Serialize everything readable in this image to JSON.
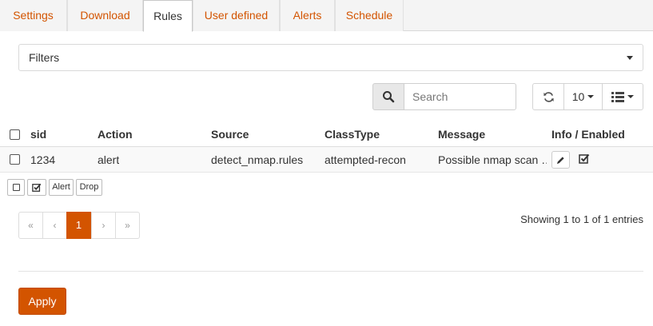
{
  "tabs": [
    {
      "label": "Settings"
    },
    {
      "label": "Download"
    },
    {
      "label": "Rules"
    },
    {
      "label": "User defined"
    },
    {
      "label": "Alerts"
    },
    {
      "label": "Schedule"
    }
  ],
  "active_tab": "Rules",
  "filters": {
    "value": "Filters"
  },
  "toolbar": {
    "search_placeholder": "Search",
    "rows_per_page": "10",
    "icons": [
      "search-icon",
      "refresh-icon",
      "list-icon"
    ]
  },
  "table": {
    "columns": [
      "sid",
      "Action",
      "Source",
      "ClassType",
      "Message",
      "Info / Enabled"
    ],
    "rows": [
      {
        "sid": "1234",
        "action": "alert",
        "source": "detect_nmap.rules",
        "classtype": "attempted-recon",
        "message": "Possible nmap scan …",
        "enabled": true
      }
    ]
  },
  "row_actions": {
    "alert_label": "Alert",
    "drop_label": "Drop"
  },
  "pagination": {
    "first": "«",
    "prev": "‹",
    "current": "1",
    "next": "›",
    "last": "»"
  },
  "info": "Showing 1 to 1 of 1 entries",
  "apply_label": "Apply",
  "colors": {
    "accent": "#d35400"
  }
}
